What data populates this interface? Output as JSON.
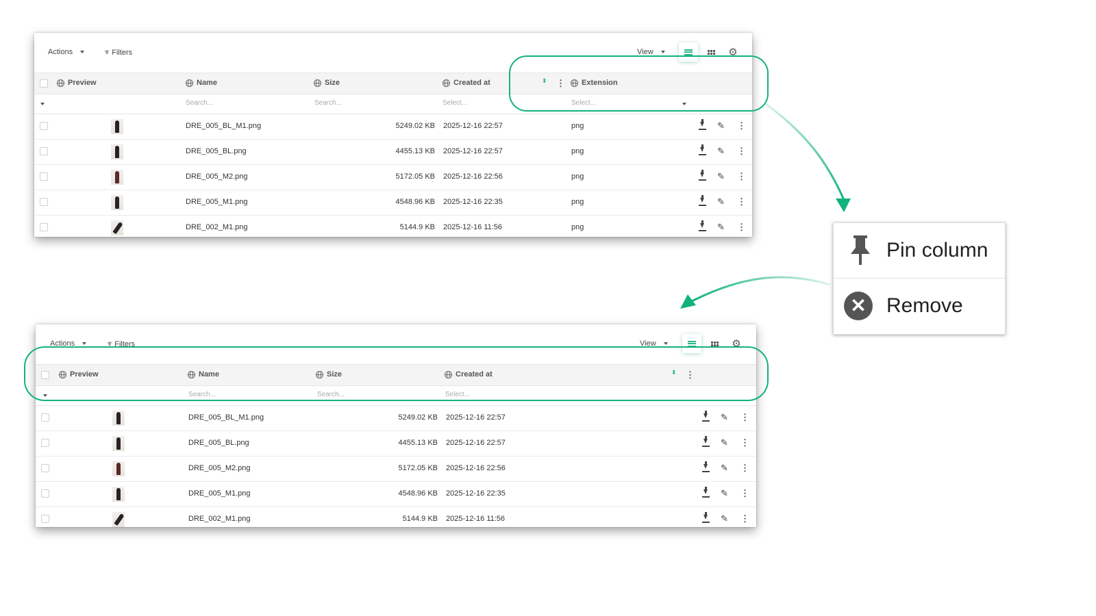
{
  "toolbar": {
    "actions_label": "Actions",
    "filters_label": "Filters",
    "view_label": "View"
  },
  "top_table": {
    "columns": [
      {
        "label": "Preview"
      },
      {
        "label": "Name"
      },
      {
        "label": "Size"
      },
      {
        "label": "Created at"
      },
      {
        "label": "Extension"
      }
    ],
    "filters": {
      "name_placeholder": "Search...",
      "size_placeholder": "Search...",
      "created_placeholder": "Select...",
      "extension_placeholder": "Select..."
    },
    "rows": [
      {
        "name": "DRE_005_BL_M1.png",
        "size": "5249.02 KB",
        "created": "2025-12-16 22:57",
        "ext": "png"
      },
      {
        "name": "DRE_005_BL.png",
        "size": "4455.13 KB",
        "created": "2025-12-16 22:57",
        "ext": "png"
      },
      {
        "name": "DRE_005_M2.png",
        "size": "5172.05 KB",
        "created": "2025-12-16 22:56",
        "ext": "png"
      },
      {
        "name": "DRE_005_M1.png",
        "size": "4548.96 KB",
        "created": "2025-12-16 22:35",
        "ext": "png"
      },
      {
        "name": "DRE_002_M1.png",
        "size": "5144.9 KB",
        "created": "2025-12-16 11:56",
        "ext": "png"
      }
    ]
  },
  "bottom_table": {
    "columns": [
      {
        "label": "Preview"
      },
      {
        "label": "Name"
      },
      {
        "label": "Size"
      },
      {
        "label": "Created at"
      }
    ],
    "filters": {
      "name_placeholder": "Search...",
      "size_placeholder": "Search...",
      "created_placeholder": "Select..."
    },
    "rows": [
      {
        "name": "DRE_005_BL_M1.png",
        "size": "5249.02 KB",
        "created": "2025-12-16 22:57"
      },
      {
        "name": "DRE_005_BL.png",
        "size": "4455.13 KB",
        "created": "2025-12-16 22:57"
      },
      {
        "name": "DRE_005_M2.png",
        "size": "5172.05 KB",
        "created": "2025-12-16 22:56"
      },
      {
        "name": "DRE_005_M1.png",
        "size": "4548.96 KB",
        "created": "2025-12-16 22:35"
      },
      {
        "name": "DRE_002_M1.png",
        "size": "5144.9 KB",
        "created": "2025-12-16 11:56"
      }
    ]
  },
  "column_menu": {
    "pin_label": "Pin column",
    "remove_label": "Remove"
  },
  "colors": {
    "accent": "#12b27e",
    "icon": "#444444",
    "header_bg": "#f4f4f4"
  },
  "icons": [
    "caret-down-icon",
    "filters-icon",
    "list-view-icon",
    "grid-view-icon",
    "gear-icon",
    "globe-icon",
    "sort-icon",
    "kebab-icon",
    "download-icon",
    "edit-icon",
    "pin-icon",
    "close-circle-icon"
  ]
}
